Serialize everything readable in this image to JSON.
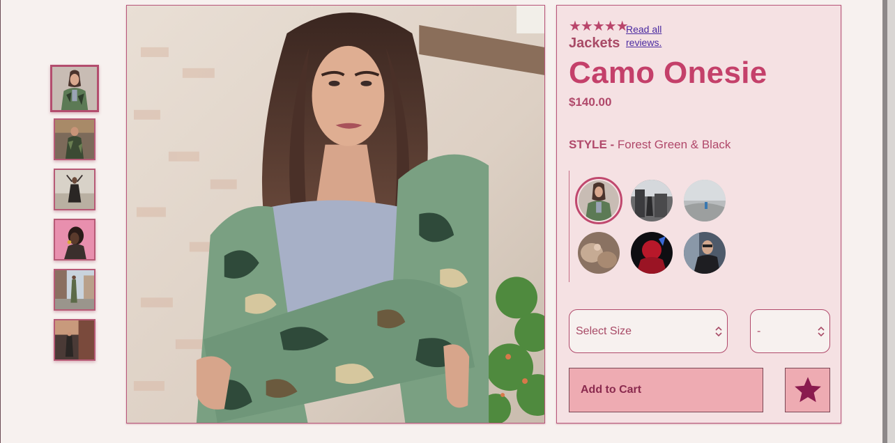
{
  "product": {
    "rating_stars": "★★★★★",
    "review_link": "Read all reviews.",
    "category": "Jackets",
    "title": "Camo Onesie",
    "price": "$140.00",
    "style_label": "STYLE -",
    "style_value": "Forest Green & Black"
  },
  "gallery": {
    "thumbnail_count": 6,
    "active_thumbnail": 1,
    "swatch_count": 6,
    "active_swatch": 1
  },
  "controls": {
    "size_select_value": "Select Size",
    "quantity_select_value": "-",
    "add_to_cart_label": "Add to Cart",
    "favorite_icon": "star-icon"
  },
  "colors": {
    "accent": "#c4406a",
    "panel_bg": "#f5e1e3",
    "button_bg": "#eeabb2",
    "page_bg": "#f7f1ef"
  }
}
